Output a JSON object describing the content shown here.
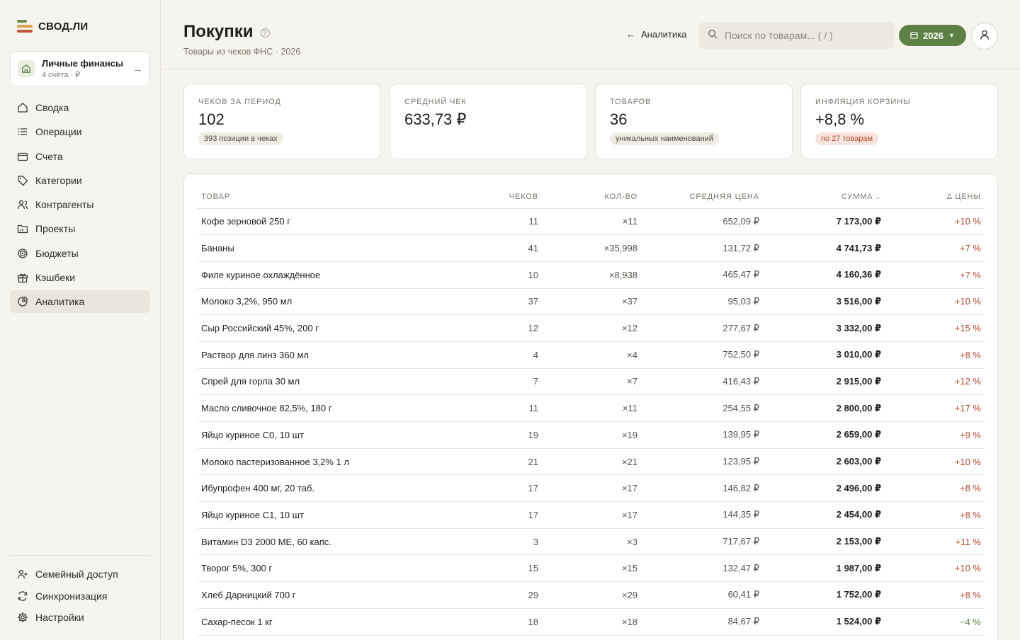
{
  "app": {
    "name": "СВОД.ЛИ"
  },
  "account": {
    "title": "Личные финансы",
    "subtitle": "4 счёта · ₽"
  },
  "nav": [
    {
      "label": "Сводка",
      "icon": "home-icon",
      "active": false
    },
    {
      "label": "Операции",
      "icon": "list-icon",
      "active": false
    },
    {
      "label": "Счета",
      "icon": "wallet-icon",
      "active": false
    },
    {
      "label": "Категории",
      "icon": "tag-icon",
      "active": false
    },
    {
      "label": "Контрагенты",
      "icon": "users-icon",
      "active": false
    },
    {
      "label": "Проекты",
      "icon": "folder-icon",
      "active": false
    },
    {
      "label": "Бюджеты",
      "icon": "target-icon",
      "active": false
    },
    {
      "label": "Кэшбеки",
      "icon": "gift-icon",
      "active": false
    },
    {
      "label": "Аналитика",
      "icon": "pie-chart-icon",
      "active": true
    }
  ],
  "nav_bottom": [
    {
      "label": "Семейный доступ",
      "icon": "family-icon"
    },
    {
      "label": "Синхронизация",
      "icon": "sync-icon"
    },
    {
      "label": "Настройки",
      "icon": "gear-icon"
    }
  ],
  "header": {
    "title": "Покупки",
    "subtitle": "Товары из чеков ФНС · 2026",
    "back_label": "Аналитика",
    "search_placeholder": "Поиск по товарам... ( / )",
    "year": "2026"
  },
  "stats": [
    {
      "label": "Чеков за период",
      "value": "102",
      "badge": "393 позиции в чеках",
      "badge_tone": "neutral"
    },
    {
      "label": "Средний чек",
      "value": "633,73 ₽",
      "badge": "",
      "badge_tone": "neutral"
    },
    {
      "label": "Товаров",
      "value": "36",
      "badge": "уникальных наименований",
      "badge_tone": "neutral"
    },
    {
      "label": "Инфляция корзины",
      "value": "+8,8 %",
      "badge": "по 27 товарам",
      "badge_tone": "red"
    }
  ],
  "table": {
    "columns": {
      "name": "Товар",
      "checks": "Чеков",
      "qty": "Кол-во",
      "avg": "Средняя цена",
      "sum": "Сумма",
      "delta": "Δ цены"
    },
    "rows": [
      {
        "name": "Кофе зерновой 250 г",
        "checks": "11",
        "qty": "×11",
        "avg": "652,09 ₽",
        "sum": "7 173,00 ₽",
        "delta": "+10 %"
      },
      {
        "name": "Бананы",
        "checks": "41",
        "qty": "×35,998",
        "avg": "131,72 ₽",
        "sum": "4 741,73 ₽",
        "delta": "+7 %"
      },
      {
        "name": "Филе куриное охлаждённое",
        "checks": "10",
        "qty": "×8,938",
        "avg": "465,47 ₽",
        "sum": "4 160,36 ₽",
        "delta": "+7 %"
      },
      {
        "name": "Молоко 3,2%, 950 мл",
        "checks": "37",
        "qty": "×37",
        "avg": "95,03 ₽",
        "sum": "3 516,00 ₽",
        "delta": "+10 %"
      },
      {
        "name": "Сыр Российский 45%, 200 г",
        "checks": "12",
        "qty": "×12",
        "avg": "277,67 ₽",
        "sum": "3 332,00 ₽",
        "delta": "+15 %"
      },
      {
        "name": "Раствор для линз 360 мл",
        "checks": "4",
        "qty": "×4",
        "avg": "752,50 ₽",
        "sum": "3 010,00 ₽",
        "delta": "+8 %"
      },
      {
        "name": "Спрей для горла 30 мл",
        "checks": "7",
        "qty": "×7",
        "avg": "416,43 ₽",
        "sum": "2 915,00 ₽",
        "delta": "+12 %"
      },
      {
        "name": "Масло сливочное 82,5%, 180 г",
        "checks": "11",
        "qty": "×11",
        "avg": "254,55 ₽",
        "sum": "2 800,00 ₽",
        "delta": "+17 %"
      },
      {
        "name": "Яйцо куриное С0, 10 шт",
        "checks": "19",
        "qty": "×19",
        "avg": "139,95 ₽",
        "sum": "2 659,00 ₽",
        "delta": "+9 %"
      },
      {
        "name": "Молоко пастеризованное 3,2% 1 л",
        "checks": "21",
        "qty": "×21",
        "avg": "123,95 ₽",
        "sum": "2 603,00 ₽",
        "delta": "+10 %"
      },
      {
        "name": "Ибупрофен 400 мг, 20 таб.",
        "checks": "17",
        "qty": "×17",
        "avg": "146,82 ₽",
        "sum": "2 496,00 ₽",
        "delta": "+8 %"
      },
      {
        "name": "Яйцо куриное С1, 10 шт",
        "checks": "17",
        "qty": "×17",
        "avg": "144,35 ₽",
        "sum": "2 454,00 ₽",
        "delta": "+8 %"
      },
      {
        "name": "Витамин D3 2000 МЕ, 60 капс.",
        "checks": "3",
        "qty": "×3",
        "avg": "717,67 ₽",
        "sum": "2 153,00 ₽",
        "delta": "+11 %"
      },
      {
        "name": "Творог 5%, 300 г",
        "checks": "15",
        "qty": "×15",
        "avg": "132,47 ₽",
        "sum": "1 987,00 ₽",
        "delta": "+10 %"
      },
      {
        "name": "Хлеб Дарницкий 700 г",
        "checks": "29",
        "qty": "×29",
        "avg": "60,41 ₽",
        "sum": "1 752,00 ₽",
        "delta": "+8 %"
      },
      {
        "name": "Сахар-песок 1 кг",
        "checks": "18",
        "qty": "×18",
        "avg": "84,67 ₽",
        "sum": "1 524,00 ₽",
        "delta": "−4 %"
      }
    ]
  },
  "colors": {
    "accent": "#5d8045",
    "price_up": "#b04a33",
    "price_down": "#5d8045",
    "background": "#f6f4ee"
  }
}
